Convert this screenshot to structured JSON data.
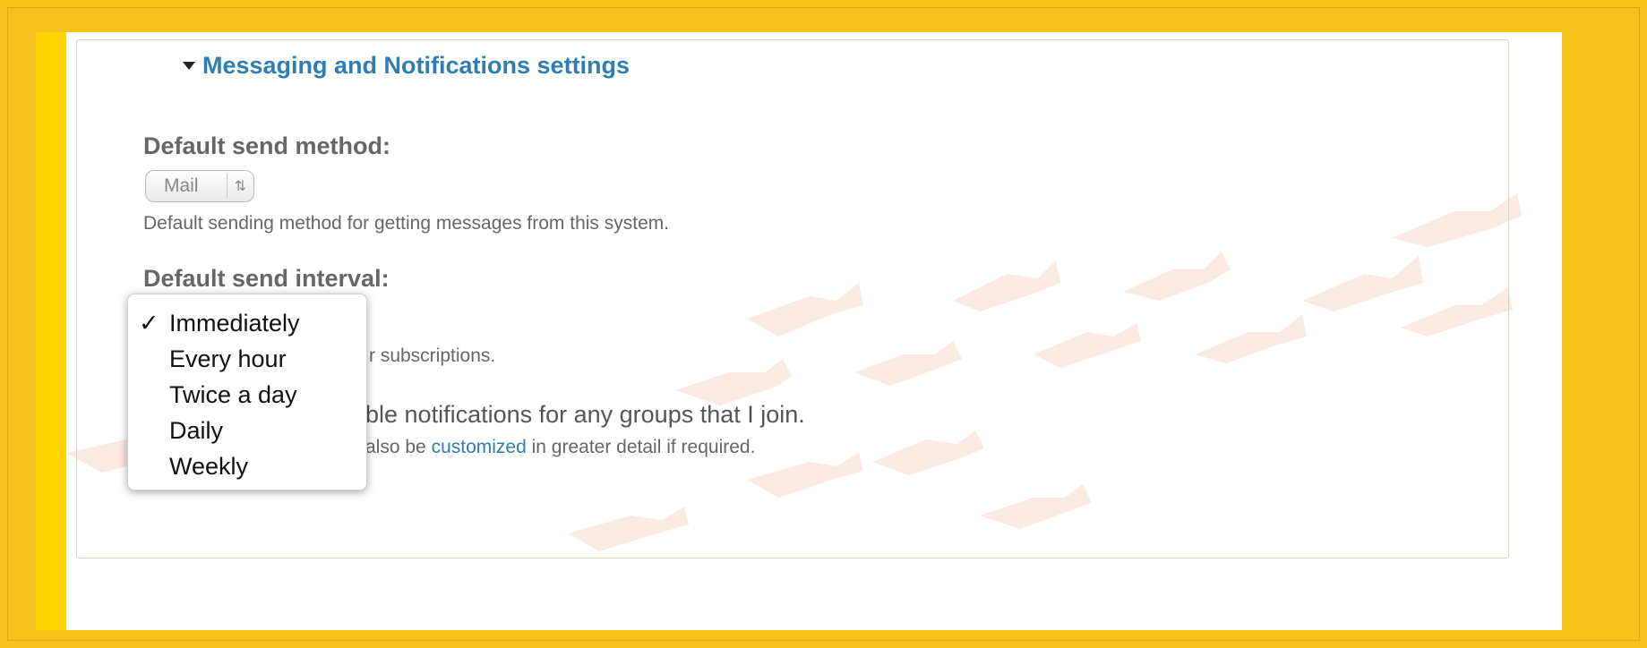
{
  "fieldset": {
    "legend": "Messaging and Notifications settings"
  },
  "send_method": {
    "label": "Default send method:",
    "value": "Mail",
    "description": "Default sending method for getting messages from this system."
  },
  "send_interval": {
    "label": "Default send interval:",
    "options": [
      {
        "label": "Immediately",
        "checked": true
      },
      {
        "label": "Every hour",
        "checked": false
      },
      {
        "label": "Twice a day",
        "checked": false
      },
      {
        "label": "Daily",
        "checked": false
      },
      {
        "label": "Weekly",
        "checked": false
      }
    ],
    "check_glyph": "✓",
    "description_visible": "r subscriptions."
  },
  "groups_notifications": {
    "label_visible": "ble notifications for any groups that I join.",
    "description_prefix": "also be",
    "link_text": "customized",
    "description_suffix": "in greater detail if required."
  },
  "colors": {
    "frame": "#f6c11d",
    "accent_strip": "#ffd400",
    "link": "#2e7db3"
  }
}
